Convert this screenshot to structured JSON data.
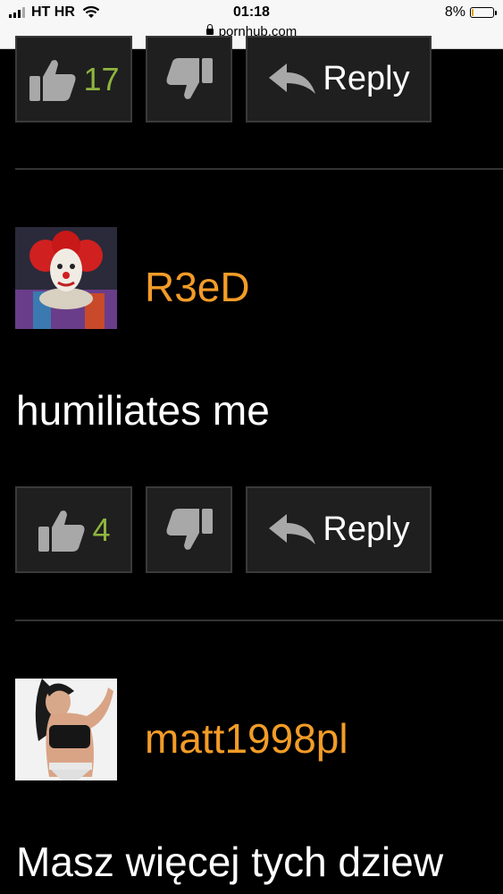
{
  "status_bar": {
    "carrier": "HT HR",
    "time": "01:18",
    "url": "pornhub.com",
    "battery": "8%",
    "battery_level": 0.08,
    "icons": [
      "signal-icon",
      "wifi-icon",
      "lock-icon",
      "battery-icon"
    ]
  },
  "top_actions": {
    "like_count": "17",
    "reply_label": "Reply"
  },
  "comments": [
    {
      "username": "R3eD",
      "text": "humiliates me",
      "like_count": "4",
      "reply_label": "Reply"
    },
    {
      "username": "matt1998pl",
      "text": "Masz więcej tych dziew"
    }
  ],
  "colors": {
    "background": "#000000",
    "username": "#f39c27",
    "like_count": "#8eb53f",
    "button_bg": "#1f1f1f",
    "icon": "#a8a8a8"
  }
}
